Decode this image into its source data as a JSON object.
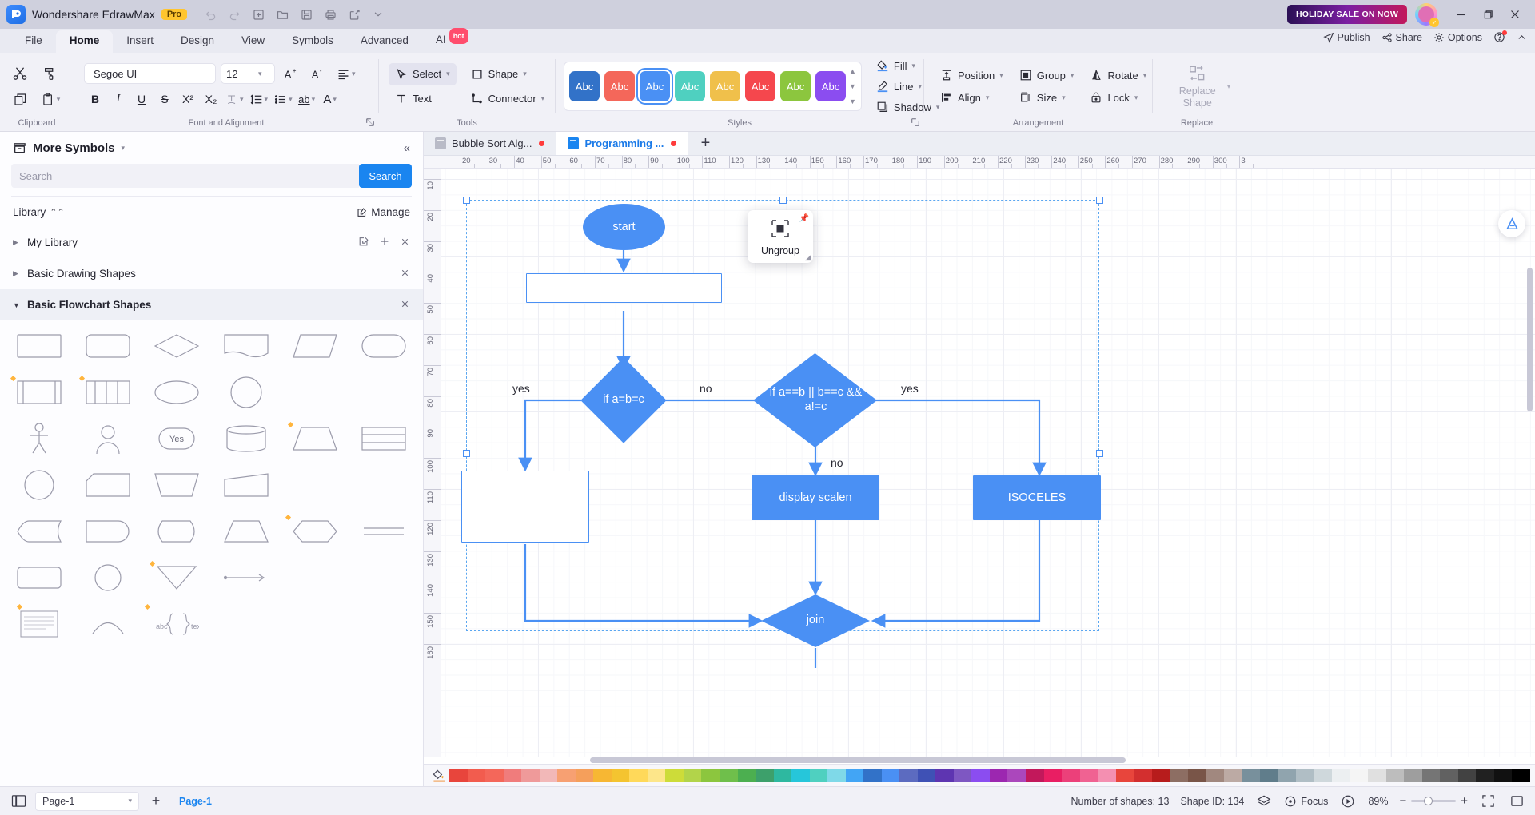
{
  "titlebar": {
    "app_name": "Wondershare EdrawMax",
    "pro_badge": "Pro",
    "sale_badge": "HOLIDAY SALE ON NOW",
    "quick_actions": [
      {
        "name": "undo-icon",
        "label": "Undo"
      },
      {
        "name": "redo-icon",
        "label": "Redo"
      },
      {
        "name": "new-file-icon",
        "label": "New"
      },
      {
        "name": "open-folder-icon",
        "label": "Open"
      },
      {
        "name": "save-icon",
        "label": "Save"
      },
      {
        "name": "print-icon",
        "label": "Print"
      },
      {
        "name": "export-share-icon",
        "label": "Export"
      },
      {
        "name": "customize-toolbar-icon",
        "label": "More"
      }
    ],
    "window_buttons": [
      "minimize",
      "maximize",
      "close"
    ]
  },
  "menu": {
    "tabs": [
      "File",
      "Home",
      "Insert",
      "Design",
      "View",
      "Symbols",
      "Advanced",
      "AI"
    ],
    "active_tab": "Home",
    "ai_badge": "hot",
    "right_items": [
      "Publish",
      "Share",
      "Options"
    ]
  },
  "ribbon": {
    "groups": [
      "Clipboard",
      "Font and Alignment",
      "Tools",
      "Styles",
      "Arrangement",
      "Replace"
    ],
    "clipboard": {
      "cut": "Cut",
      "format_painter": "Format Painter",
      "copy": "Copy",
      "paste": "Paste"
    },
    "font": {
      "family": "Segoe UI",
      "family_placeholder": "Font",
      "size": "12",
      "increase_size": "A+",
      "decrease_size": "A-",
      "bold": "B",
      "italic": "I",
      "underline": "U",
      "strikethrough": "S",
      "superscript": "X²",
      "subscript": "X₂",
      "text_effect": "T",
      "line_spacing": "Line Spacing",
      "bullets": "Bullets",
      "highlight": "ab",
      "font_color": "A",
      "alignment": "Alignment"
    },
    "tools": {
      "select": "Select",
      "shape": "Shape",
      "text": "Text",
      "connector": "Connector"
    },
    "styles": {
      "swatches": [
        {
          "color": "#3272c8",
          "label": "Abc",
          "selected": false
        },
        {
          "color": "#f4675a",
          "label": "Abc",
          "selected": false
        },
        {
          "color": "#4a90f4",
          "label": "Abc",
          "selected": true
        },
        {
          "color": "#4fd0c0",
          "label": "Abc",
          "selected": false
        },
        {
          "color": "#f0c04b",
          "label": "Abc",
          "selected": false
        },
        {
          "color": "#f5474d",
          "label": "Abc",
          "selected": false
        },
        {
          "color": "#8cc63e",
          "label": "Abc",
          "selected": false
        },
        {
          "color": "#8b4df0",
          "label": "Abc",
          "selected": false
        }
      ],
      "fill": "Fill",
      "line": "Line",
      "shadow": "Shadow"
    },
    "arrangement": {
      "position": "Position",
      "group": "Group",
      "rotate": "Rotate",
      "align": "Align",
      "size": "Size",
      "lock": "Lock"
    },
    "replace": {
      "line1": "Replace",
      "line2": "Shape"
    }
  },
  "sidebar": {
    "title": "More Symbols",
    "search_placeholder": "Search",
    "search_value": "",
    "search_button": "Search",
    "library_label": "Library",
    "manage_label": "Manage",
    "categories": [
      {
        "label": "My Library",
        "expanded": false,
        "closable": true
      },
      {
        "label": "Basic Drawing Shapes",
        "expanded": false,
        "closable": true
      },
      {
        "label": "Basic Flowchart Shapes",
        "expanded": true,
        "closable": true
      }
    ]
  },
  "doctabs": {
    "tabs": [
      {
        "label": "Bubble Sort Alg...",
        "active": false,
        "modified": true
      },
      {
        "label": "Programming ...",
        "active": true,
        "modified": true
      }
    ],
    "add_tab": "+"
  },
  "canvas": {
    "h_ruler_labels": [
      "20",
      "30",
      "40",
      "50",
      "60",
      "70",
      "80",
      "90",
      "100",
      "110",
      "120",
      "130",
      "140",
      "150",
      "160",
      "170",
      "180",
      "190",
      "200",
      "210",
      "220",
      "230",
      "240",
      "250",
      "260",
      "270",
      "280",
      "290",
      "300",
      "3"
    ],
    "v_ruler_labels": [
      "10",
      "20",
      "30",
      "40",
      "50",
      "60",
      "70",
      "80",
      "90",
      "100",
      "110",
      "120",
      "130",
      "140",
      "150",
      "160"
    ],
    "popup": {
      "label": "Ungroup"
    },
    "nodes": [
      {
        "id": "start",
        "text": "start",
        "shape": "ellipse"
      },
      {
        "id": "input",
        "text": "",
        "shape": "rect-empty"
      },
      {
        "id": "cond1",
        "text": "if a=b=c",
        "shape": "diamond"
      },
      {
        "id": "cond2",
        "text": "if a==b || b==c && a!=c",
        "shape": "diamond"
      },
      {
        "id": "equilateral",
        "text": "",
        "shape": "rect-empty"
      },
      {
        "id": "scalene",
        "text": "display scalen",
        "shape": "rect"
      },
      {
        "id": "isoceles",
        "text": "ISOCELES",
        "shape": "rect"
      },
      {
        "id": "join",
        "text": "join",
        "shape": "diamond"
      }
    ],
    "edge_labels": [
      "yes",
      "no",
      "yes",
      "no"
    ]
  },
  "statusbar": {
    "page_name": "Page-1",
    "page_tab": "Page-1",
    "add_page": "+",
    "shape_count": "Number of shapes: 13",
    "shape_id": "Shape ID: 134",
    "focus": "Focus",
    "zoom": "89%",
    "zoom_out": "−",
    "zoom_in": "+"
  },
  "palette": {
    "colors": [
      "#e8453c",
      "#f25c4e",
      "#f4675a",
      "#f07c7c",
      "#ef9a9a",
      "#f2b8b8",
      "#f7a072",
      "#f59f5b",
      "#f7b733",
      "#f4c430",
      "#ffd95a",
      "#fde68a",
      "#cddc39",
      "#b2d44a",
      "#8cc63e",
      "#6fbf4b",
      "#4caf50",
      "#3da06b",
      "#2eb8a0",
      "#26c6da",
      "#4fd0c0",
      "#7fd9e8",
      "#42a5f5",
      "#3272c8",
      "#4a90f4",
      "#5c6bc0",
      "#3f51b5",
      "#5e35b1",
      "#7e57c2",
      "#8b4df0",
      "#9c27b0",
      "#ab47bc",
      "#c2185b",
      "#e91e63",
      "#ec407a",
      "#f06292",
      "#f48fb1",
      "#e8453c",
      "#d32f2f",
      "#b71c1c",
      "#8d6e63",
      "#795548",
      "#a1887f",
      "#bcaaa4",
      "#78909c",
      "#607d8b",
      "#90a4ae",
      "#b0bec5",
      "#cfd8dc",
      "#eceff1",
      "#f5f5f5",
      "#e0e0e0",
      "#bdbdbd",
      "#9e9e9e",
      "#757575",
      "#616161",
      "#424242",
      "#212121",
      "#111111",
      "#000000"
    ]
  }
}
